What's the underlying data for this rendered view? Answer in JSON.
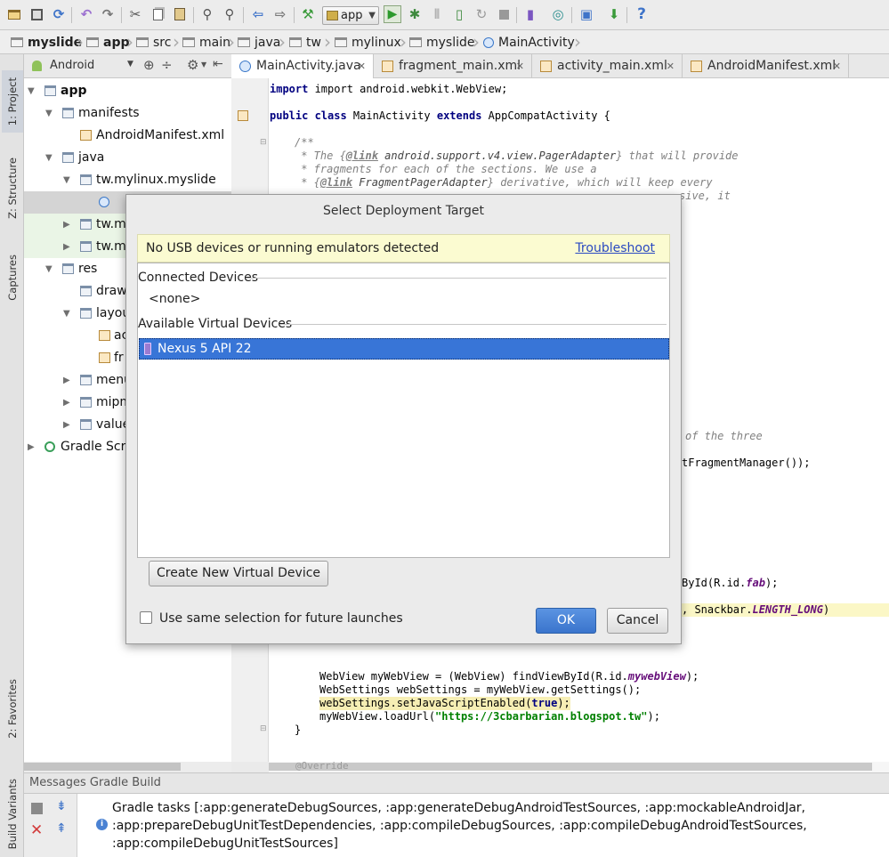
{
  "toolbar": {
    "run_config": "app",
    "icons": [
      "open-icon",
      "save-icon",
      "sync-icon",
      "undo-icon",
      "redo-icon",
      "cut-icon",
      "copy-icon",
      "paste-icon",
      "find-icon",
      "replace-icon",
      "back-icon",
      "forward-icon",
      "make-icon",
      "run-icon",
      "debug-icon",
      "attach-debugger-icon",
      "run-coverage-icon",
      "apply-changes-icon",
      "stop-icon",
      "avd-manager-icon",
      "sdk-manager-icon",
      "project-structure-icon",
      "gradle-sync-icon",
      "help-icon"
    ]
  },
  "breadcrumbs": [
    "myslide",
    "app",
    "src",
    "main",
    "java",
    "tw",
    "mylinux",
    "myslide",
    "MainActivity"
  ],
  "left_strip": {
    "project": "1: Project",
    "structure": "Z: Structure",
    "captures": "Captures",
    "favorites": "2: Favorites",
    "build_variants": "Build Variants"
  },
  "project_panel": {
    "view_mode": "Android",
    "tree": [
      {
        "label": "app",
        "depth": 0,
        "icon": "folder",
        "expanded": true,
        "bold": true
      },
      {
        "label": "manifests",
        "depth": 1,
        "icon": "folder",
        "expanded": true
      },
      {
        "label": "AndroidManifest.xml",
        "depth": 2,
        "icon": "xml"
      },
      {
        "label": "java",
        "depth": 1,
        "icon": "folder",
        "expanded": true
      },
      {
        "label": "tw.mylinux.myslide",
        "depth": 2,
        "icon": "folder",
        "expanded": true
      },
      {
        "label": "",
        "depth": 3,
        "icon": "class",
        "selected": true
      },
      {
        "label": "tw.m",
        "depth": 2,
        "icon": "folder",
        "expanded": false
      },
      {
        "label": "tw.m",
        "depth": 2,
        "icon": "folder",
        "expanded": false
      },
      {
        "label": "res",
        "depth": 1,
        "icon": "folder",
        "expanded": true
      },
      {
        "label": "draw",
        "depth": 2,
        "icon": "folder"
      },
      {
        "label": "layou",
        "depth": 2,
        "icon": "folder",
        "expanded": true
      },
      {
        "label": "ac",
        "depth": 3,
        "icon": "xml"
      },
      {
        "label": "fr",
        "depth": 3,
        "icon": "xml"
      },
      {
        "label": "menu",
        "depth": 2,
        "icon": "folder",
        "expanded": false
      },
      {
        "label": "mipm",
        "depth": 2,
        "icon": "folder",
        "expanded": false
      },
      {
        "label": "value",
        "depth": 2,
        "icon": "folder",
        "expanded": false
      },
      {
        "label": "Gradle Scr",
        "depth": 0,
        "icon": "gradle",
        "expanded": false
      }
    ]
  },
  "editor_tabs": [
    {
      "label": "MainActivity.java",
      "active": true,
      "icon": "class"
    },
    {
      "label": "fragment_main.xml",
      "active": false,
      "icon": "xml"
    },
    {
      "label": "activity_main.xml",
      "active": false,
      "icon": "xml"
    },
    {
      "label": "AndroidManifest.xml",
      "active": false,
      "icon": "xml"
    }
  ],
  "code": {
    "l1": "import android.webkit.WebView;",
    "l2a": "public class ",
    "l2b": "MainActivity ",
    "l2c": "extends ",
    "l2d": "AppCompatActivity {",
    "l3": "/**",
    "l4a": " * The {",
    "l4b": "@link",
    "l4c": " android.support.v4.view.PagerAdapter",
    "l4d": "} that will provide",
    "l5": " * fragments for each of the sections. We use a",
    "l6a": " * {",
    "l6b": "@link",
    "l6c": " FragmentPagerAdapter",
    "l6d": "} derivative, which will keep every",
    "l7": "sive, it",
    "l8": "of the three",
    "l9": "tFragmentManager());",
    "l10a": "ById(R.id.",
    "l10b": "fab",
    "l10c": ");",
    "l11a": ", Snackbar.",
    "l11b": "LENGTH_LONG",
    "l11c": ")",
    "l12a": "WebView myWebView = (WebView) findViewById(R.id.",
    "l12b": "mywebView",
    "l12c": ");",
    "l13": "WebSettings webSettings = myWebView.getSettings();",
    "l14a": "webSettings.setJavaScriptEnabled(",
    "l14b": "true",
    "l14c": ");",
    "l15a": "myWebView.loadUrl(",
    "l15b": "\"https://3cbarbarian.blogspot.tw\"",
    "l15c": ");",
    "l16": "}",
    "l17": "@Override"
  },
  "messages": {
    "header": "Messages Gradle Build",
    "line1": "Gradle tasks [:app:generateDebugSources, :app:generateDebugAndroidTestSources, :app:mockableAndroidJar,",
    "line2": ":app:prepareDebugUnitTestDependencies, :app:compileDebugSources, :app:compileDebugAndroidTestSources,",
    "line3": ":app:compileDebugUnitTestSources]"
  },
  "dialog": {
    "title": "Select Deployment Target",
    "warning": "No USB devices or running emulators detected",
    "troubleshoot": "Troubleshoot",
    "connected_header": "Connected Devices",
    "connected_none": "<none>",
    "virtual_header": "Available Virtual Devices",
    "virtual_devices": [
      "Nexus 5 API 22"
    ],
    "create_button": "Create New Virtual Device",
    "checkbox_label": "Use same selection for future launches",
    "checkbox_checked": false,
    "ok": "OK",
    "cancel": "Cancel"
  }
}
